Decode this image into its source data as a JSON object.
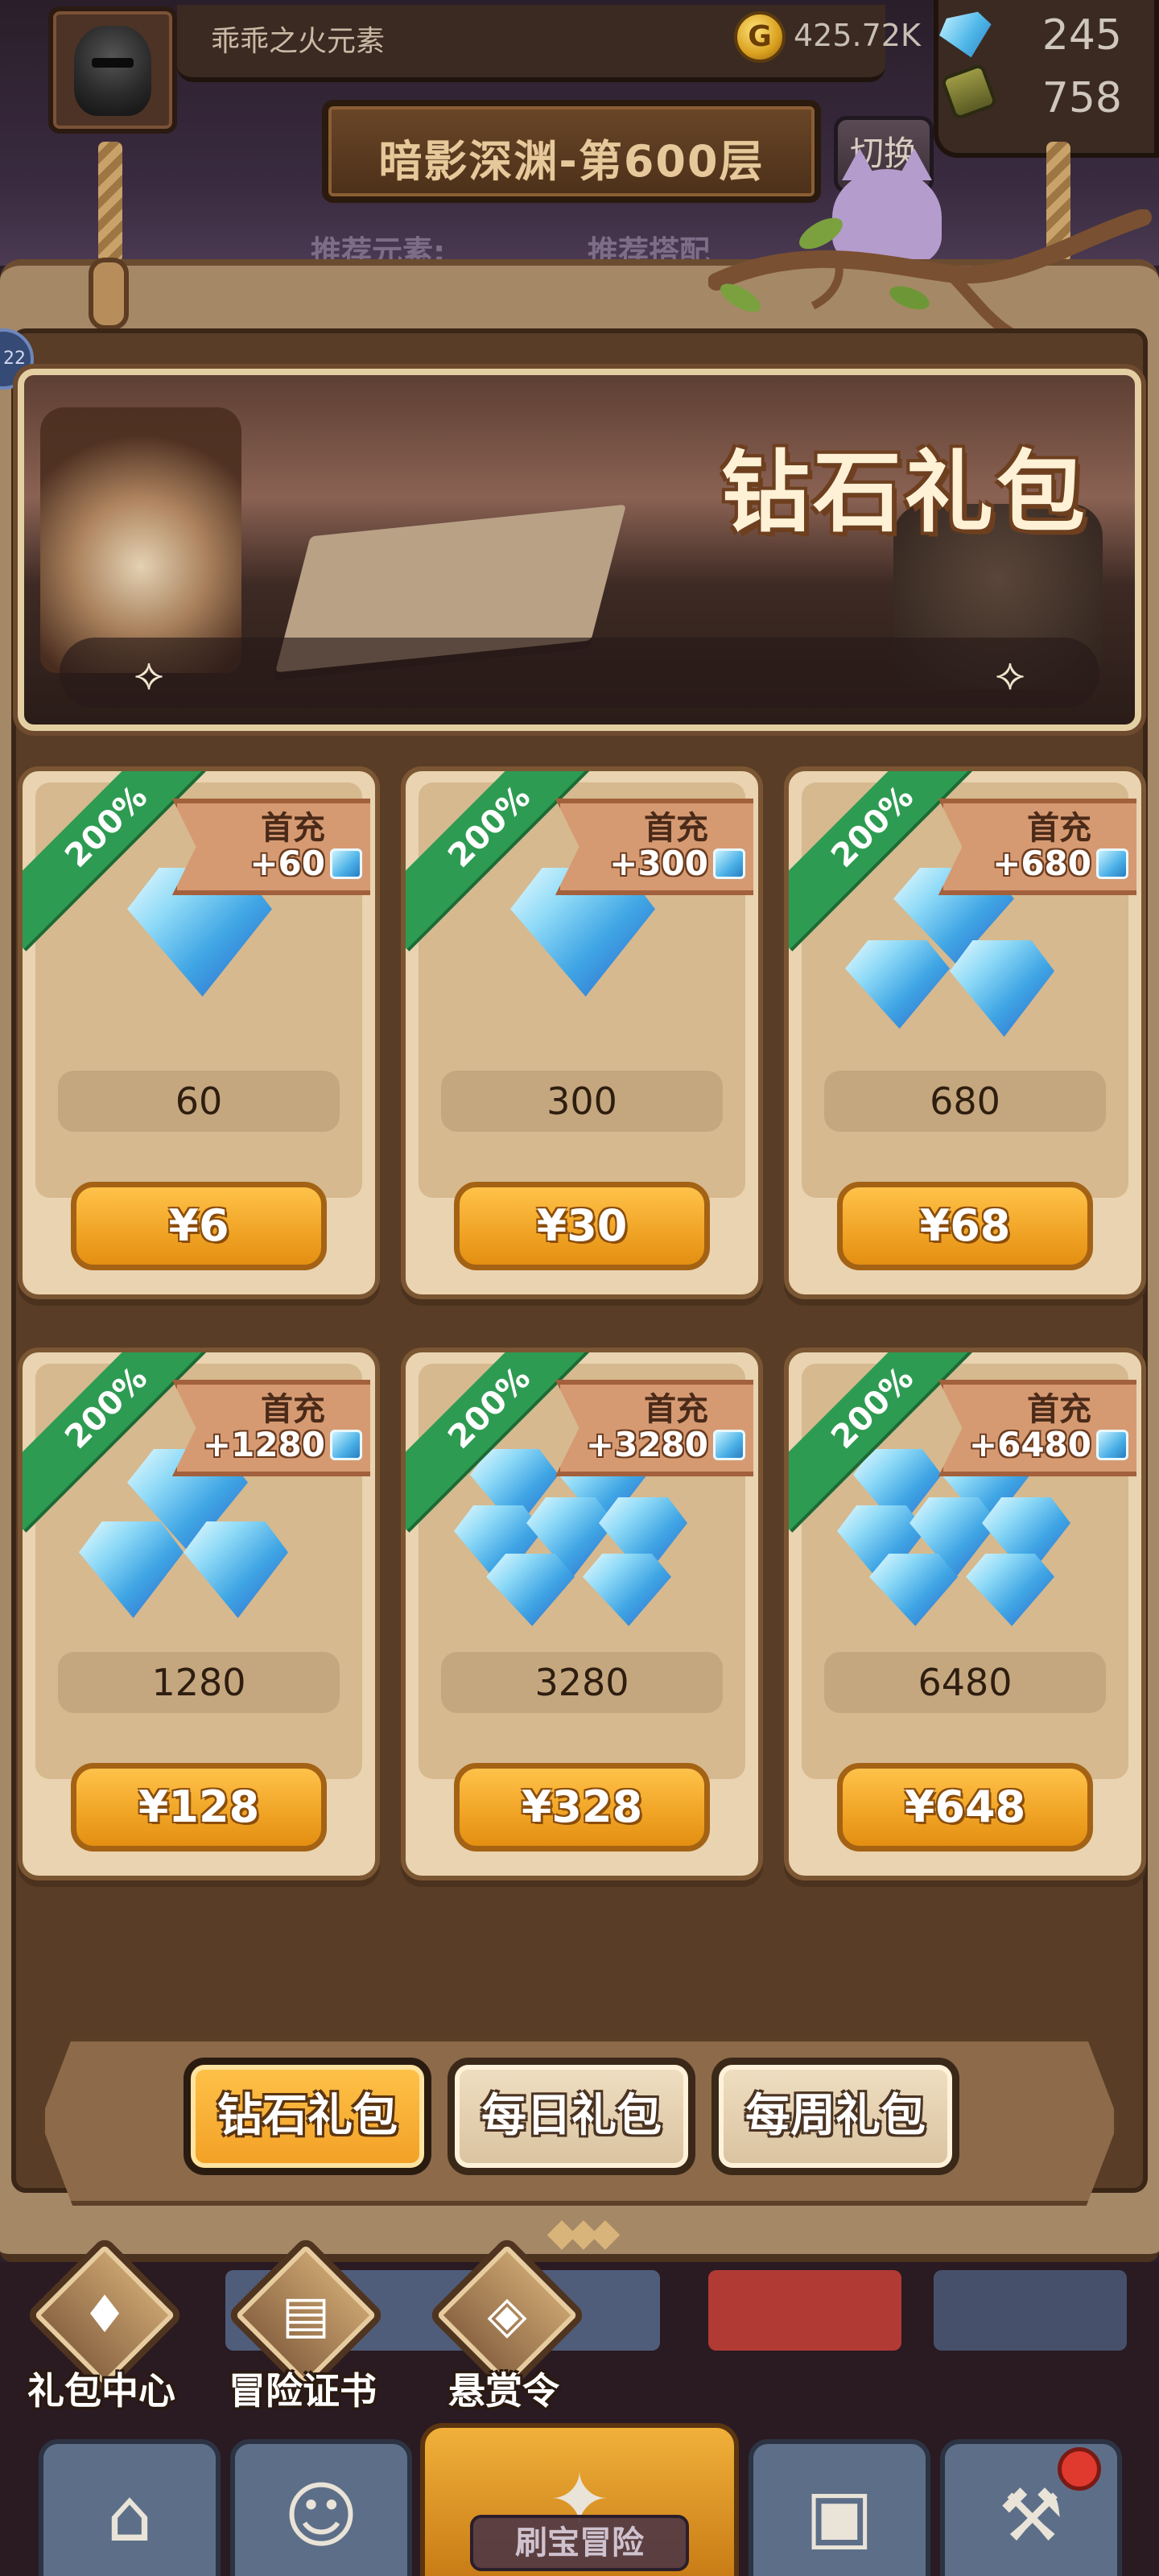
{
  "hud": {
    "player_name": "乖乖之火元素",
    "gold_icon_glyph": "G",
    "gold_amount": "425.72K",
    "gem_count": "245",
    "energy_count": "758",
    "stage_title": "暗影深渊-第600层",
    "switch_label": "切换",
    "recommend_element": "推荐元素:",
    "recommend_combo": "推荐搭配",
    "side_badge": "22"
  },
  "banner": {
    "title": "钻石礼包",
    "arrow_left": "⟡",
    "arrow_right": "⟡"
  },
  "packs": [
    {
      "ribbon": "200%",
      "first_label": "首充",
      "bonus": "+60",
      "amount": "60",
      "price": "¥6"
    },
    {
      "ribbon": "200%",
      "first_label": "首充",
      "bonus": "+300",
      "amount": "300",
      "price": "¥30"
    },
    {
      "ribbon": "200%",
      "first_label": "首充",
      "bonus": "+680",
      "amount": "680",
      "price": "¥68"
    },
    {
      "ribbon": "200%",
      "first_label": "首充",
      "bonus": "+1280",
      "amount": "1280",
      "price": "¥128"
    },
    {
      "ribbon": "200%",
      "first_label": "首充",
      "bonus": "+3280",
      "amount": "3280",
      "price": "¥328"
    },
    {
      "ribbon": "200%",
      "first_label": "首充",
      "bonus": "+6480",
      "amount": "6480",
      "price": "¥648"
    }
  ],
  "tabs": [
    {
      "label": "钻石礼包",
      "active": true
    },
    {
      "label": "每日礼包",
      "active": false
    },
    {
      "label": "每周礼包",
      "active": false
    }
  ],
  "quick_actions": [
    {
      "label": "礼包中心",
      "icon": "diamond-icon",
      "glyph": "♦"
    },
    {
      "label": "冒险证书",
      "icon": "book-icon",
      "glyph": "▤"
    },
    {
      "label": "悬赏令",
      "icon": "target-icon",
      "glyph": "◈"
    }
  ],
  "bottom_nav": {
    "center_label": "刷宝冒险",
    "icons": [
      "shop-icon",
      "hero-icon",
      "compass-icon",
      "backpack-icon",
      "forge-icon"
    ]
  },
  "colors": {
    "price_button": "#f0a324",
    "ribbon_green": "#2e9b52",
    "panel_tan": "#a58866",
    "active_tab": "#ffc24a"
  }
}
